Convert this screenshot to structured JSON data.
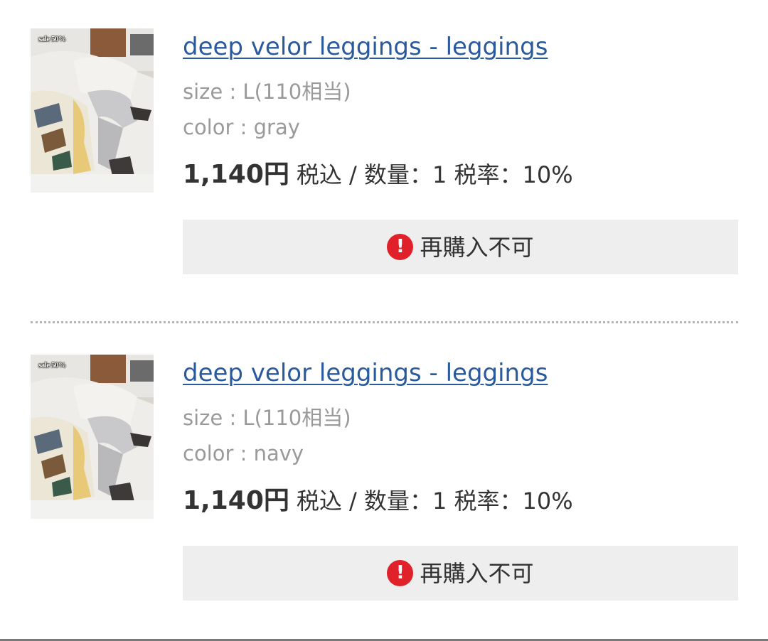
{
  "items": [
    {
      "image_badge": "sale 50%",
      "title": "deep velor leggings - leggings",
      "size": "size : L(110相当)",
      "color": "color : gray",
      "price": "1,140円",
      "price_note": "税込 / 数量：1 税率：10%",
      "rebuy_icon": "!",
      "rebuy_label": "再購入不可"
    },
    {
      "image_badge": "sale 50%",
      "title": "deep velor leggings - leggings",
      "size": "size : L(110相当)",
      "color": "color : navy",
      "price": "1,140円",
      "price_note": "税込 / 数量：1 税率：10%",
      "rebuy_icon": "!",
      "rebuy_label": "再購入不可"
    }
  ],
  "icons": {
    "rebuy_icon": "exclamation-circle-icon",
    "rebuy_icon_color": "#e0212a"
  },
  "colors": {
    "link": "#2a5a9e",
    "muted_text": "#9a9a9a",
    "body_text": "#333333",
    "bar_background": "#eeeeee"
  }
}
